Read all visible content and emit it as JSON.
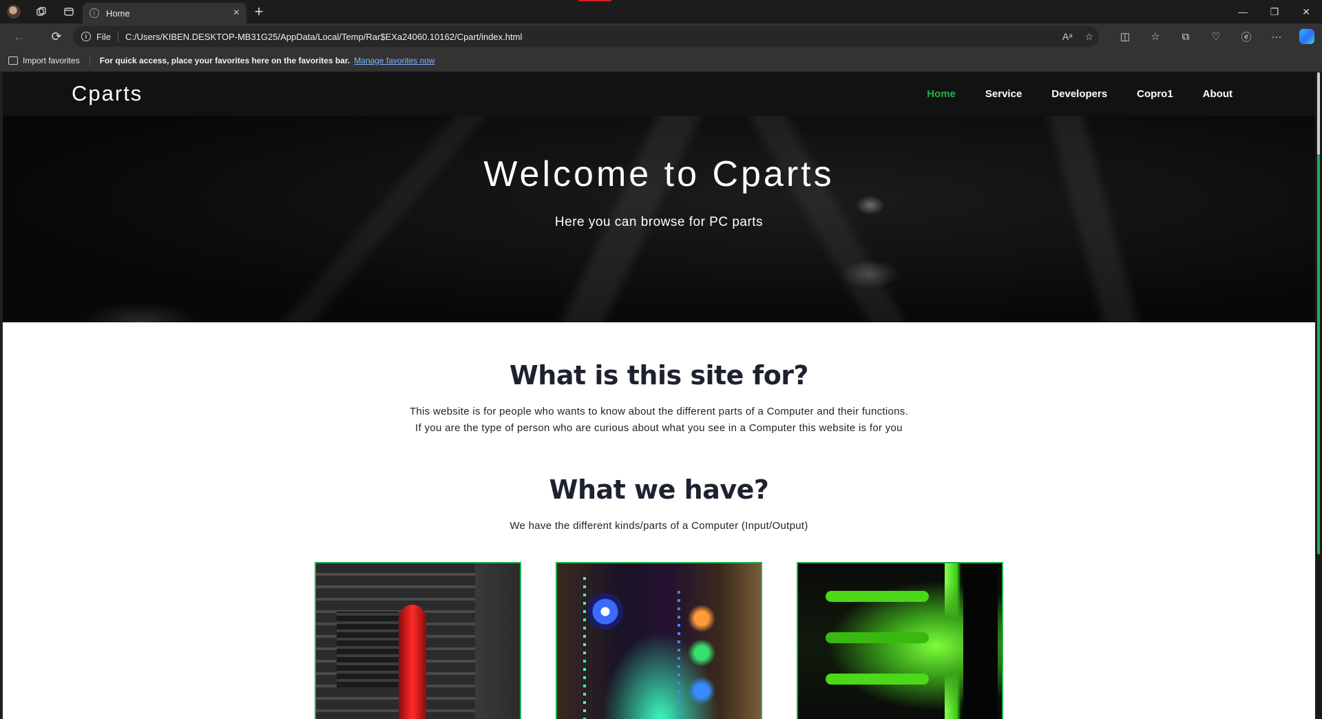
{
  "browser": {
    "tab": {
      "title": "Home"
    },
    "address": {
      "scheme_label": "File",
      "url": "C:/Users/KIBEN.DESKTOP-MB31G25/AppData/Local/Temp/Rar$EXa24060.10162/Cpart/index.html"
    },
    "favorites_bar": {
      "import_label": "Import favorites",
      "message": "For quick access, place your favorites here on the favorites bar.",
      "link": "Manage favorites now"
    },
    "icons": [
      "profile-avatar",
      "workspaces-icon",
      "tab-actions-icon",
      "new-tab-icon",
      "back-icon",
      "refresh-icon",
      "info-icon",
      "read-aloud-icon",
      "favorite-star-icon",
      "split-screen-icon",
      "favorites-icon",
      "collections-icon",
      "browser-essentials-icon",
      "edge-feature-icon",
      "more-icon",
      "copilot-icon"
    ]
  },
  "site": {
    "brand": "Cparts",
    "nav": [
      {
        "label": "Home",
        "active": true
      },
      {
        "label": "Service",
        "active": false
      },
      {
        "label": "Developers",
        "active": false
      },
      {
        "label": "Copro1",
        "active": false
      },
      {
        "label": "About",
        "active": false
      }
    ],
    "accent_color": "#22b14c",
    "hero": {
      "title": "Welcome to Cparts",
      "subtitle": "Here you can browse for PC parts"
    },
    "about": {
      "heading": "What is this site for?",
      "line1": "This website is for people who wants to know about the different parts of a Computer and their functions.",
      "line2": "If you are the type of person who are curious about what you see in a Computer this website is for you"
    },
    "offer": {
      "heading": "What we have?",
      "text": "We have the different kinds/parts of a Computer (Input/Output)"
    },
    "cards": [
      "red-pc-build-image",
      "rgb-pc-build-image",
      "green-pc-build-image"
    ]
  }
}
